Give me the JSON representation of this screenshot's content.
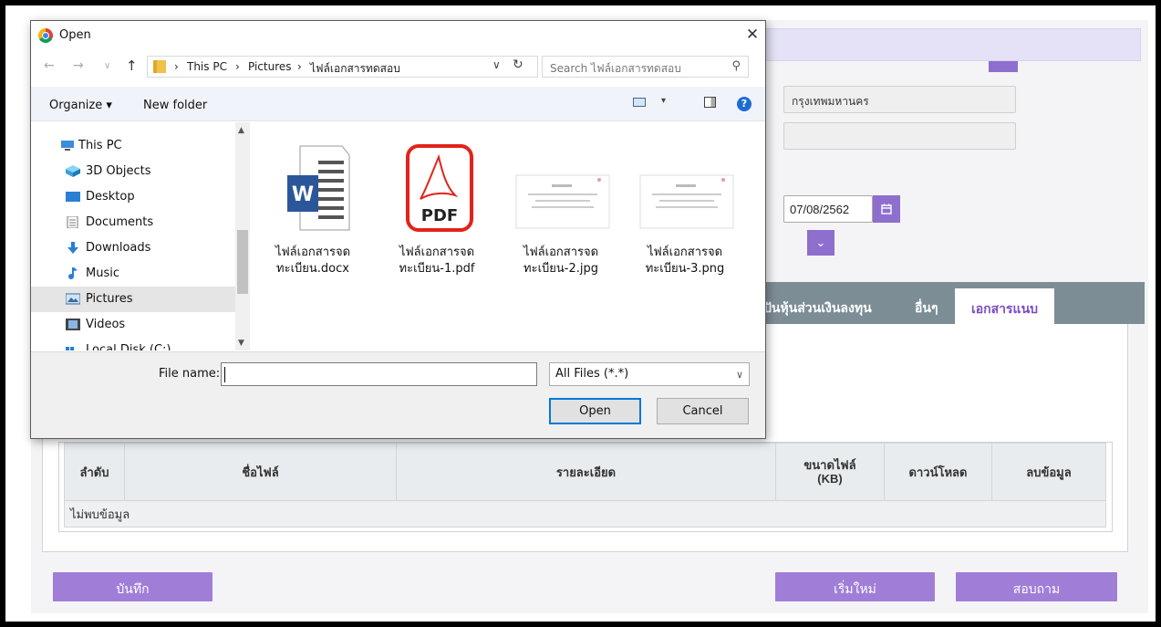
{
  "page": {
    "province_value": "กรุงเทพมหานคร",
    "date_value": "07/08/2562",
    "tabs": [
      "ปันหุ้นส่วนเงินลงทุน",
      "อื่นๆ"
    ],
    "active_tab": "เอกสารแนบ",
    "table": {
      "headers": [
        "ลำดับ",
        "ชื่อไฟล์",
        "รายละเอียด",
        "ขนาดไฟล์\n(KB)",
        "ดาวน์โหลด",
        "ลบข้อมูล"
      ],
      "empty_message": "ไม่พบข้อมูล"
    },
    "buttons": {
      "save": "บันทึก",
      "reset": "เริ่มใหม่",
      "inquire": "สอบถาม"
    },
    "accent_color": "#a07ed8"
  },
  "dialog": {
    "title": "Open",
    "breadcrumb": [
      "This PC",
      "Pictures",
      "ไฟล์เอกสารทดสอบ"
    ],
    "search_placeholder": "Search ไฟล์เอกสารทดสอบ",
    "organize_label": "Organize ▾",
    "new_folder_label": "New folder",
    "help_label": "?",
    "nav_items": [
      {
        "label": "This PC",
        "icon": "pc-icon"
      },
      {
        "label": "3D Objects",
        "icon": "cube-icon"
      },
      {
        "label": "Desktop",
        "icon": "desktop-icon"
      },
      {
        "label": "Documents",
        "icon": "document-icon"
      },
      {
        "label": "Downloads",
        "icon": "download-icon"
      },
      {
        "label": "Music",
        "icon": "music-icon"
      },
      {
        "label": "Pictures",
        "icon": "pictures-icon",
        "selected": true
      },
      {
        "label": "Videos",
        "icon": "video-icon"
      },
      {
        "label": "Local Disk (C:)",
        "icon": "disk-icon"
      }
    ],
    "files": [
      {
        "name_line1": "ไฟล์เอกสารจด",
        "name_line2": "ทะเบียน.docx",
        "icon": "word-icon"
      },
      {
        "name_line1": "ไฟล์เอกสารจด",
        "name_line2": "ทะเบียน-1.pdf",
        "icon": "pdf-icon",
        "icon_text": "PDF"
      },
      {
        "name_line1": "ไฟล์เอกสารจด",
        "name_line2": "ทะเบียน-2.jpg",
        "icon": "image-thumbnail"
      },
      {
        "name_line1": "ไฟล์เอกสารจด",
        "name_line2": "ทะเบียน-3.png",
        "icon": "image-thumbnail"
      }
    ],
    "file_name_label": "File name:",
    "file_name_value": "",
    "filter_value": "All Files (*.*)",
    "open_label": "Open",
    "cancel_label": "Cancel",
    "word_badge": "W"
  }
}
